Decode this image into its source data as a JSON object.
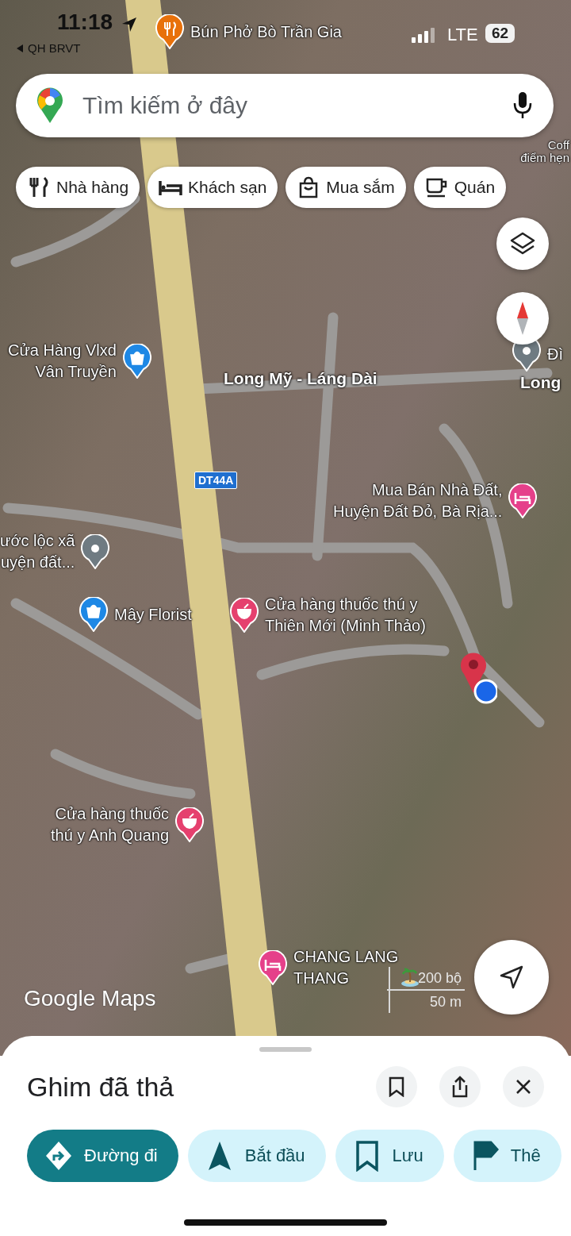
{
  "status_bar": {
    "time": "11:18",
    "back_label": "QH BRVT",
    "network": "LTE",
    "battery": "62"
  },
  "search": {
    "placeholder": "Tìm kiếm ở đây"
  },
  "categories": [
    {
      "label": "Nhà hàng"
    },
    {
      "label": "Khách sạn"
    },
    {
      "label": "Mua sắm"
    },
    {
      "label": "Quán"
    }
  ],
  "map": {
    "labels": [
      {
        "kind": "restaurant",
        "color": "#e8710a",
        "lines": [
          "Bún Phở Bò Trần Gia"
        ]
      },
      {
        "kind": "text",
        "lines": [
          "Coff",
          "điểm hẹn"
        ]
      },
      {
        "kind": "shop",
        "color": "#1e88e5",
        "lines": [
          "Cửa Hàng Vlxd",
          "Vân Truyền"
        ]
      },
      {
        "kind": "place",
        "color": "#6f7b82",
        "lines": [
          "Đì"
        ]
      },
      {
        "kind": "hotel",
        "color": "#e5408a",
        "lines": [
          "Mua Bán Nhà Đất,",
          "Huyện Đất Đỏ, Bà Rịa..."
        ]
      },
      {
        "kind": "place",
        "color": "#6f7b82",
        "lines": [
          "ước lộc xã",
          "uyện đất..."
        ]
      },
      {
        "kind": "shop",
        "color": "#1e88e5",
        "lines": [
          "Mây Florist"
        ]
      },
      {
        "kind": "pharmacy",
        "color": "#e5406e",
        "lines": [
          "Cửa hàng thuốc thú y",
          "Thiên Mới (Minh Thảo)"
        ]
      },
      {
        "kind": "pharmacy",
        "color": "#e5406e",
        "lines": [
          "Cửa hàng thuốc",
          "thú y Anh Quang"
        ]
      },
      {
        "kind": "hotel",
        "color": "#e5408a",
        "lines": [
          "CHANG LANG",
          "THANG"
        ]
      }
    ],
    "roads": [
      "Long Mỹ - Láng Dài",
      "Long"
    ],
    "road_shield": "DT44A",
    "scale": {
      "imperial": "200 bộ",
      "metric": "50 m"
    },
    "logo": "Google Maps"
  },
  "place_sheet": {
    "title": "Ghim đã thả",
    "actions": [
      {
        "label": "Đường đi",
        "kind": "primary"
      },
      {
        "label": "Bắt đầu",
        "kind": "secondary"
      },
      {
        "label": "Lưu",
        "kind": "secondary"
      },
      {
        "label": "Thê",
        "kind": "secondary"
      }
    ]
  }
}
